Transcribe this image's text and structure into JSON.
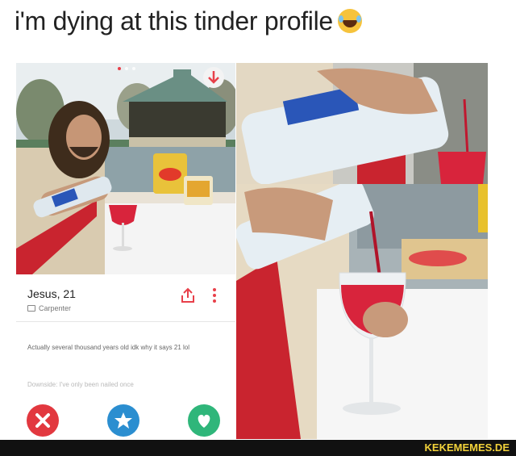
{
  "caption": "i'm dying at this tinder profile",
  "caption_emoji": "face-with-tears-of-joy-icon",
  "profile": {
    "name_age": "Jesus, 21",
    "occupation": "Carpenter",
    "bio": "Actually several thousand years old idk why it says 21 lol",
    "downside": "Downside: I've only been nailed once"
  },
  "icons": {
    "share": "share-icon",
    "more": "more-vertical-icon",
    "dislike": "close-icon",
    "superlike": "star-icon",
    "like": "heart-icon"
  },
  "colors": {
    "dislike": "#e2383f",
    "superlike": "#2b8ed0",
    "like": "#2fb67a",
    "accent": "#e8404a"
  },
  "watermark": "KEKEMEMES.DE"
}
